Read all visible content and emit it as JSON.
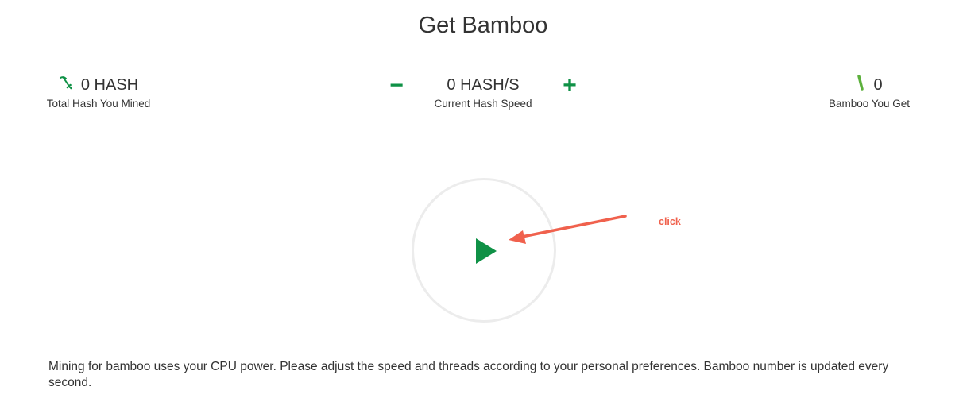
{
  "page": {
    "title": "Get Bamboo"
  },
  "stats": {
    "total_hash": {
      "value": "0 HASH",
      "caption": "Total Hash You Mined",
      "icon": "pickaxe-icon"
    },
    "hash_speed": {
      "value": "0 HASH/S",
      "caption": "Current Hash Speed"
    },
    "bamboo": {
      "value": "0",
      "caption": "Bamboo You Get",
      "icon": "bamboo-icon"
    }
  },
  "controls": {
    "decrease_label": "−",
    "increase_label": "+"
  },
  "annotation": {
    "text": "click"
  },
  "description": "Mining for bamboo uses your CPU power. Please adjust the speed and threads according to your personal preferences. Bamboo number is updated every second.",
  "colors": {
    "accent": "#0f9146",
    "annotation": "#f0614d",
    "ring": "#ececec"
  }
}
